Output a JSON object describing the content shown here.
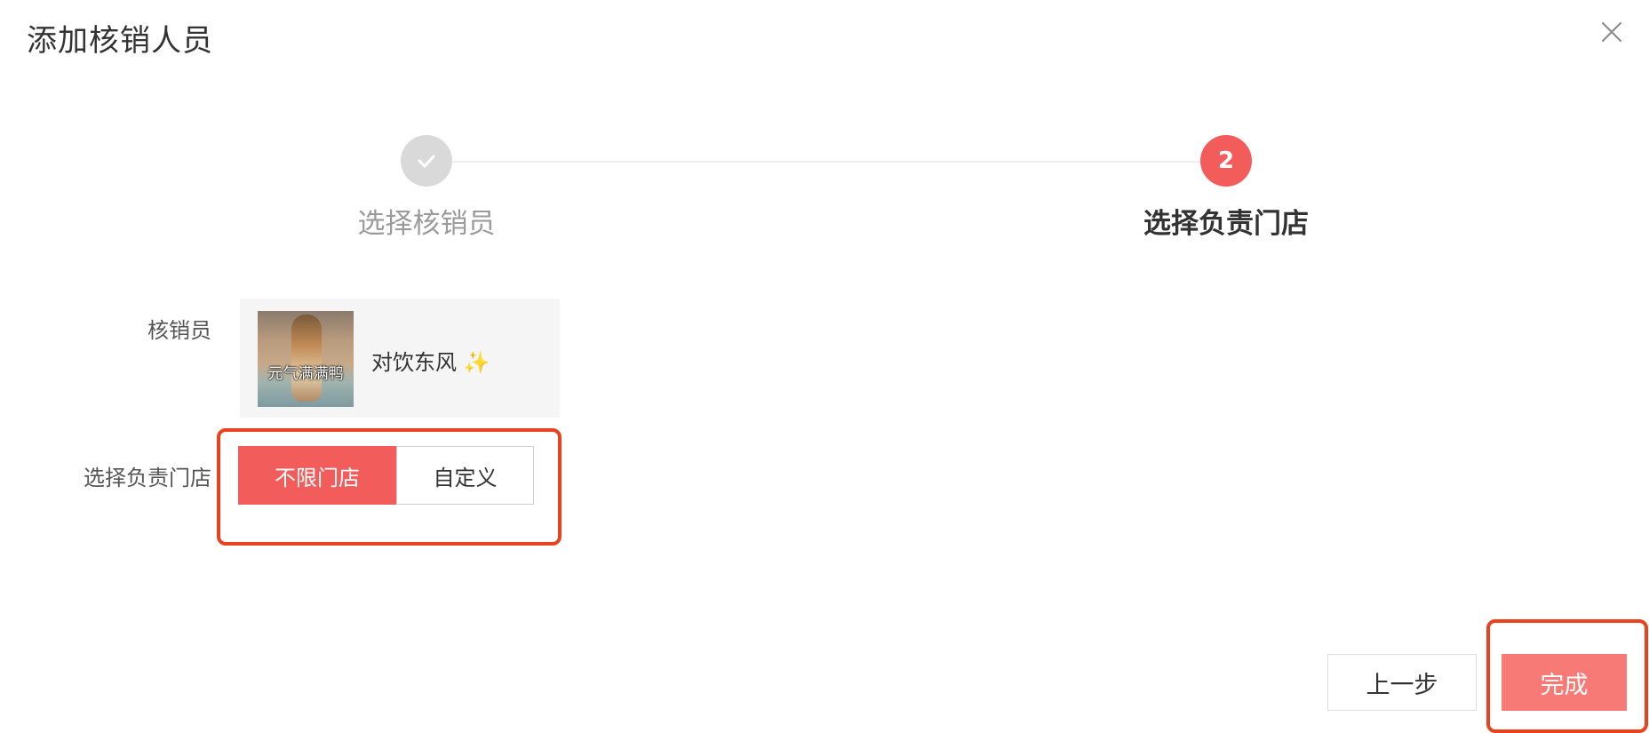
{
  "dialog": {
    "title": "添加核销人员"
  },
  "steps": [
    {
      "label": "选择核销员",
      "state": "completed"
    },
    {
      "number": "2",
      "label": "选择负责门店",
      "state": "active"
    }
  ],
  "form": {
    "staff_label": "核销员",
    "staff": {
      "name": "对饮东风 ✨",
      "avatar_caption": "元气满满鸭"
    },
    "store_label": "选择负责门店",
    "store_options": [
      {
        "label": "不限门店",
        "selected": true
      },
      {
        "label": "自定义",
        "selected": false
      }
    ]
  },
  "footer": {
    "prev_label": "上一步",
    "done_label": "完成"
  },
  "colors": {
    "accent": "#f25c5a",
    "done_button": "#f77a76",
    "highlight": "#e8431e",
    "completed_step": "#d9d9d9"
  }
}
